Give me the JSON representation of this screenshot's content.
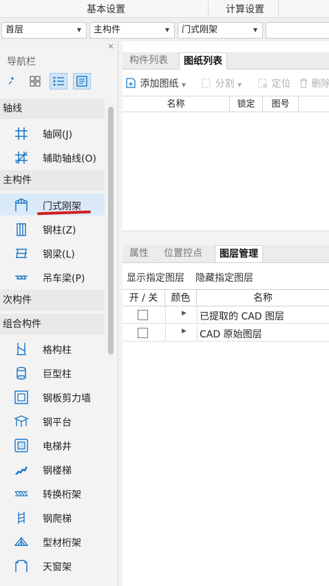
{
  "ribbon": {
    "tabs": [
      "基本设置",
      "计算设置"
    ]
  },
  "selectors": {
    "floor": "首层",
    "category": "主构件",
    "type": "门式刚架"
  },
  "nav": {
    "title": "导航栏",
    "close": "×",
    "groups": [
      {
        "label": "轴线",
        "items": [
          {
            "label": "轴网(J)",
            "icon": "grid-icon"
          },
          {
            "label": "辅助轴线(O)",
            "icon": "aux-axis-icon"
          }
        ]
      },
      {
        "label": "主构件",
        "items": [
          {
            "label": "门式刚架",
            "icon": "portal-frame-icon",
            "selected": true
          },
          {
            "label": "钢柱(Z)",
            "icon": "steel-column-icon"
          },
          {
            "label": "钢梁(L)",
            "icon": "steel-beam-icon"
          },
          {
            "label": "吊车梁(P)",
            "icon": "crane-beam-icon"
          }
        ]
      },
      {
        "label": "次构件",
        "items": []
      },
      {
        "label": "组合构件",
        "items": [
          {
            "label": "格构柱",
            "icon": "lattice-column-icon"
          },
          {
            "label": "巨型柱",
            "icon": "mega-column-icon"
          },
          {
            "label": "钢板剪力墙",
            "icon": "steel-shear-wall-icon"
          },
          {
            "label": "钢平台",
            "icon": "steel-platform-icon"
          },
          {
            "label": "电梯井",
            "icon": "elevator-shaft-icon"
          },
          {
            "label": "钢楼梯",
            "icon": "steel-stair-icon"
          },
          {
            "label": "转换桁架",
            "icon": "transfer-truss-icon"
          },
          {
            "label": "钢爬梯",
            "icon": "steel-ladder-icon"
          },
          {
            "label": "型材桁架",
            "icon": "profile-truss-icon"
          },
          {
            "label": "天窗架",
            "icon": "skylight-frame-icon"
          }
        ]
      }
    ]
  },
  "top_panel": {
    "tabs": [
      "构件列表",
      "图纸列表"
    ],
    "active_tab": "图纸列表",
    "toolbar": {
      "add": "添加图纸",
      "split": "分割",
      "locate": "定位",
      "delete": "删除"
    },
    "columns": [
      "名称",
      "锁定",
      "图号"
    ]
  },
  "bottom_panel": {
    "tabs": [
      "属性",
      "位置控点",
      "图层管理"
    ],
    "active_tab": "图层管理",
    "actions": {
      "show": "显示指定图层",
      "hide": "隐藏指定图层"
    },
    "columns": [
      "开 / 关",
      "颜色",
      "名称"
    ],
    "rows": [
      {
        "name": "已提取的 CAD 图层"
      },
      {
        "name": "CAD 原始图层"
      }
    ]
  },
  "colors": {
    "selected_bg": "#dbeaf8",
    "icon_blue": "#1e78c8",
    "underline_red": "#d21e1e"
  }
}
